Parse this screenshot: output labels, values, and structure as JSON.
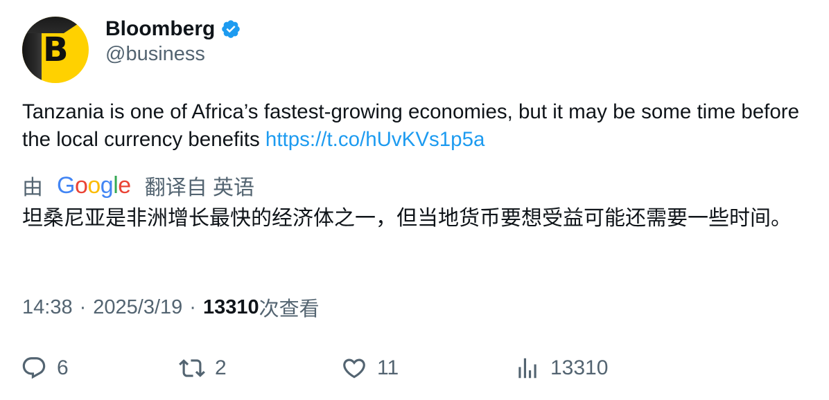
{
  "author": {
    "display_name": "Bloomberg",
    "handle": "@business",
    "avatar_letter": "B",
    "verified": true
  },
  "tweet": {
    "text": "Tanzania is one of Africa’s fastest-growing economies, but it may be some time before the local currency benefits",
    "link": "https://t.co/hUvKVs1p5a"
  },
  "translation": {
    "prefix": "由",
    "provider": "Google",
    "suffix": "翻译自 英语",
    "text": "坦桑尼亚是非洲增长最快的经济体之一，但当地货币要想受益可能还需要一些时间。"
  },
  "meta": {
    "time": "14:38",
    "separator": "·",
    "date": "2025/3/19",
    "views_count": "13310",
    "views_label": "次查看"
  },
  "actions": {
    "replies": "6",
    "retweets": "2",
    "likes": "11",
    "views": "13310"
  },
  "colors": {
    "link": "#1d9bf0",
    "secondary_text": "#536471",
    "primary_text": "#0f1419",
    "avatar_bg": "#ffd100"
  },
  "icons": {
    "verified": "verified-badge-icon",
    "reply": "reply-icon",
    "retweet": "retweet-icon",
    "like": "heart-icon",
    "views": "analytics-icon"
  }
}
